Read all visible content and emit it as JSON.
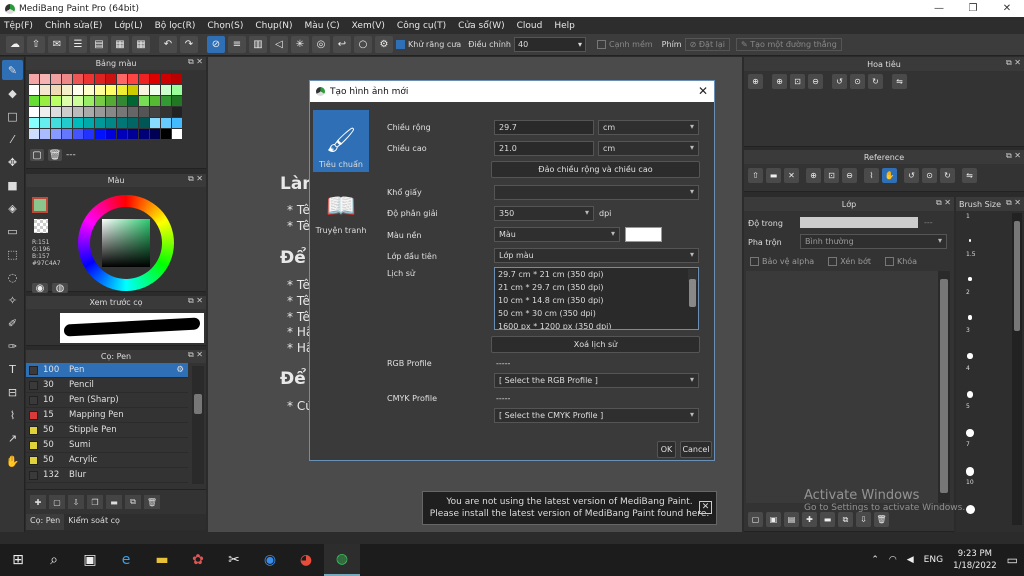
{
  "window": {
    "title": "MediBang Paint Pro (64bit)",
    "minimize": "—",
    "maximize": "❐",
    "close": "✕"
  },
  "menu": [
    "Tệp(F)",
    "Chỉnh sửa(E)",
    "Lớp(L)",
    "Bộ lọc(R)",
    "Chọn(S)",
    "Chụp(N)",
    "Màu (C)",
    "Xem(V)",
    "Công cụ(T)",
    "Cửa sổ(W)",
    "Cloud",
    "Help"
  ],
  "toolbar": {
    "antialias": "Khử răng cưa",
    "adjust_label": "Điều chỉnh",
    "adjust_value": "40",
    "edge": "Cạnh mềm",
    "key_label": "Phím",
    "setup": "Đặt lại",
    "new_line": "Tạo một đường thẳng"
  },
  "panels": {
    "palette_title": "Bảng màu",
    "palette_footer": "---",
    "color_title": "Màu",
    "rgb_r": "R:151",
    "rgb_g": "G:196",
    "rgb_b": "B:157",
    "rgb_hex": "#97C4A7",
    "preview_title": "Xem trước cọ",
    "brush_title": "Cọ: Pen",
    "brushes": [
      {
        "size": "100",
        "name": "Pen",
        "color": "#3a3a3a",
        "selected": true
      },
      {
        "size": "30",
        "name": "Pencil",
        "color": "#3a3a3a"
      },
      {
        "size": "10",
        "name": "Pen (Sharp)",
        "color": "#3a3a3a"
      },
      {
        "size": "15",
        "name": "Mapping Pen",
        "color": "#d93a3a"
      },
      {
        "size": "50",
        "name": "Stipple Pen",
        "color": "#e0d23a"
      },
      {
        "size": "50",
        "name": "Sumi",
        "color": "#e0d23a"
      },
      {
        "size": "50",
        "name": "Acrylic",
        "color": "#e0d23a"
      },
      {
        "size": "132",
        "name": "Blur",
        "color": "#3a3a3a"
      }
    ],
    "tab_brush": "Cọ: Pen",
    "tab_material": "Kiểm soát cọ"
  },
  "canvas_text": {
    "h1": "Làm",
    "b1": "* Tê",
    "b2": "* Tê",
    "h2": "Để l",
    "b3": "* Tê",
    "b4": "* Tê",
    "b5": "* Tê",
    "b6": "* Hã",
    "b7": "* Hã",
    "h3": "Để l",
    "b8": "* Cú"
  },
  "dialog": {
    "title": "Tạo hình ảnh mới",
    "close": "✕",
    "preset_standard": "Tiêu chuẩn",
    "preset_comic": "Truyện tranh",
    "width_label": "Chiều rộng",
    "width_value": "29.7",
    "width_unit": "cm",
    "height_label": "Chiều cao",
    "height_value": "21.0",
    "height_unit": "cm",
    "swap_button": "Đảo chiều rộng và chiều cao",
    "paper_label": "Khổ giấy",
    "paper_value": "",
    "dpi_label": "Độ phân giải",
    "dpi_value": "350",
    "dpi_unit": "dpi",
    "bg_label": "Màu nền",
    "bg_value": "Màu",
    "first_layer_label": "Lớp đầu tiên",
    "first_layer_value": "Lớp màu",
    "history_label": "Lịch sử",
    "history": [
      "29.7 cm * 21 cm (350 dpi)",
      "21 cm * 29.7 cm (350 dpi)",
      "10 cm * 14.8 cm (350 dpi)",
      "50 cm * 30 cm (350 dpi)",
      "1600 px * 1200 px (350 dpi)"
    ],
    "clear_history": "Xoá lịch sử",
    "rgb_label": "RGB Profile",
    "rgb_dash": "-----",
    "rgb_select": "[ Select the RGB Profile ]",
    "cmyk_label": "CMYK Profile",
    "cmyk_dash": "-----",
    "cmyk_select": "[ Select the CMYK Profile ]",
    "ok": "OK",
    "cancel": "Cancel"
  },
  "right": {
    "navigator_title": "Hoa tiêu",
    "reference_title": "Reference",
    "layer_title": "Lớp",
    "opacity_label": "Độ trong",
    "opacity_value": "---",
    "blend_label": "Pha trộn",
    "blend_value": "Bình thường",
    "protect_alpha": "Bảo vệ alpha",
    "clipping": "Xén bớt",
    "lock": "Khóa",
    "brushsize_title": "Brush Size",
    "sizes": [
      "1",
      ".",
      "1.5",
      ".",
      "2",
      ".",
      "3",
      ".",
      "4",
      ".",
      "5",
      ".",
      "7",
      ".",
      "10",
      "."
    ]
  },
  "notice": {
    "line1": "You are not using the latest version of MediBang Paint.",
    "line2": "Please install the latest version of MediBang Paint found here.",
    "close": "✕"
  },
  "watermark": {
    "line1": "Activate Windows",
    "line2": "Go to Settings to activate Windows."
  },
  "taskbar": {
    "lang": "ENG",
    "time": "9:23 PM",
    "date": "1/18/2022"
  }
}
